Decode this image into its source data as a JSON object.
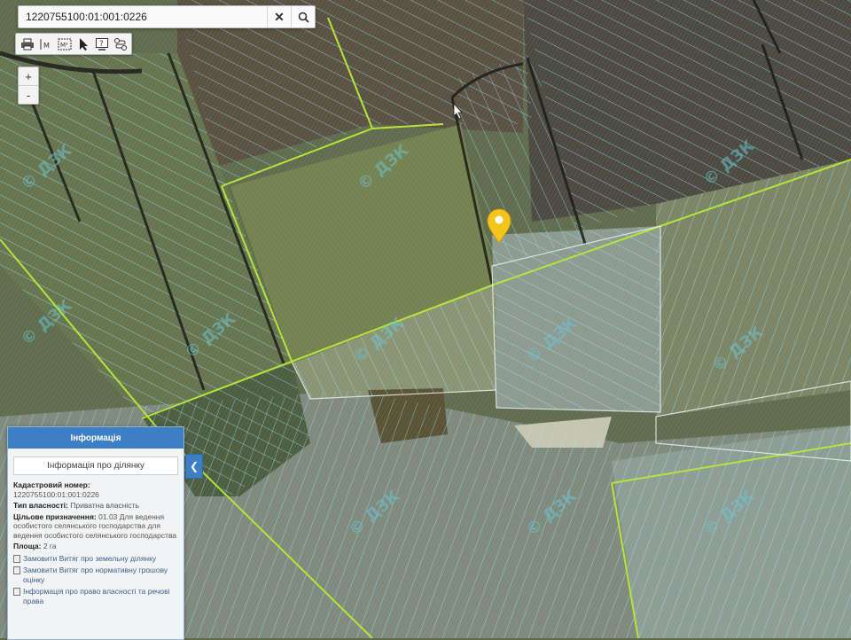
{
  "search": {
    "value": "1220755100:01:001:0226"
  },
  "toolbar": {
    "tools": [
      "print-icon",
      "measure-length-icon",
      "measure-area-icon",
      "pointer-icon",
      "help-icon",
      "route-icon"
    ],
    "measure_length_label": "M",
    "measure_area_label": "M²"
  },
  "zoom": {
    "in": "+",
    "out": "-"
  },
  "watermark": "© ДЗК",
  "panel": {
    "header": "Інформація",
    "subtitle": "Інформація про ділянку",
    "cadastral_label": "Кадастровий номер:",
    "cadastral_value": "1220755100:01:001:0226",
    "ownership_label": "Тип власності:",
    "ownership_value": "Приватна власність",
    "purpose_label": "Цільове призначення:",
    "purpose_value": "01.03 Для ведення особистого селянського господарства для ведення особистого селянського господарства",
    "area_label": "Площа:",
    "area_value": "2 га",
    "links": [
      "Замовити Витяг про земельну ділянку",
      "Замовити Витяг про нормативну грошову оцінку",
      "Інформація про право власності та речові права"
    ]
  },
  "colors": {
    "accent": "#3c7fc4",
    "parcel_line": "#8fe6ff",
    "boundary_line": "#b6e43a",
    "marker": "#f4c51c"
  }
}
